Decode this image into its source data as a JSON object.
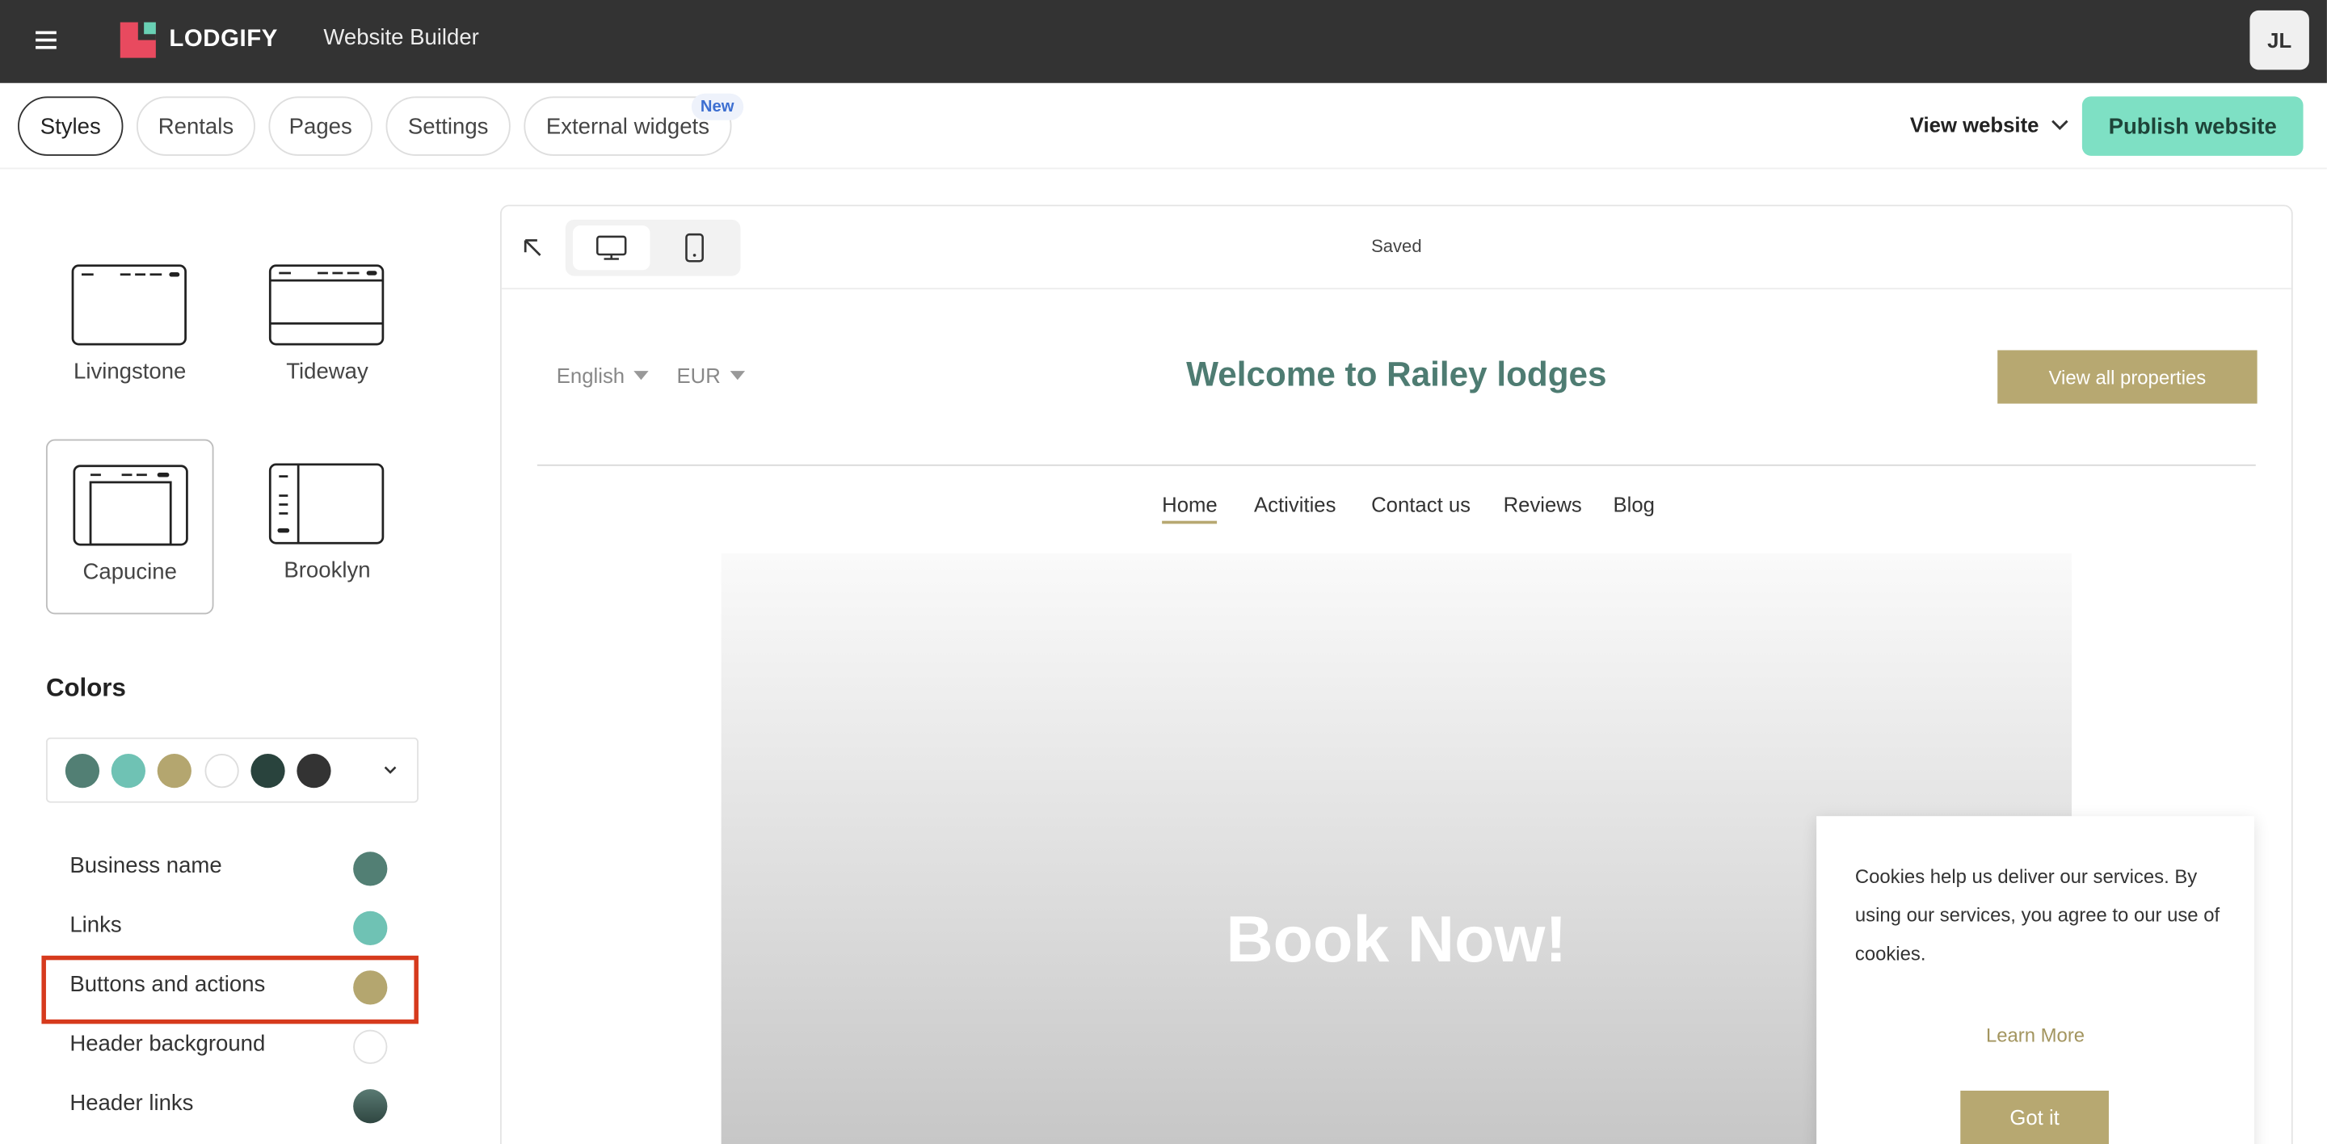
{
  "topbar": {
    "logo_text": "LODGIFY",
    "app_title": "Website Builder",
    "avatar_initials": "JL"
  },
  "tabs": {
    "items": [
      {
        "label": "Styles",
        "active": true
      },
      {
        "label": "Rentals",
        "active": false
      },
      {
        "label": "Pages",
        "active": false
      },
      {
        "label": "Settings",
        "active": false
      },
      {
        "label": "External widgets",
        "active": false
      }
    ],
    "new_badge": "New",
    "view_website": "View website",
    "publish": "Publish website"
  },
  "sidebar": {
    "layouts": [
      {
        "name": "Livingstone",
        "selected": false
      },
      {
        "name": "Tideway",
        "selected": false
      },
      {
        "name": "Capucine",
        "selected": true
      },
      {
        "name": "Brooklyn",
        "selected": false
      }
    ],
    "colors_title": "Colors",
    "palette": [
      "#527f74",
      "#6fc2b4",
      "#b4a66f",
      "#ffffff",
      "#29433d",
      "#333333"
    ],
    "color_rows": [
      {
        "label": "Business name",
        "color": "#527f74"
      },
      {
        "label": "Links",
        "color": "#6fc2b4"
      },
      {
        "label": "Buttons and actions",
        "color": "#b4a66f"
      },
      {
        "label": "Header background",
        "color": "#ffffff"
      },
      {
        "label": "Header links",
        "color": "#44605a"
      }
    ]
  },
  "preview": {
    "status": "Saved",
    "site": {
      "language": "English",
      "currency": "EUR",
      "title": "Welcome to Railey lodges",
      "cta": "View all properties",
      "nav": [
        "Home",
        "Activities",
        "Contact us",
        "Reviews",
        "Blog"
      ],
      "hero_text": "Book Now!"
    },
    "cookie": {
      "text": "Cookies help us deliver our services. By using our services, you agree to our use of cookies.",
      "learn_more": "Learn More",
      "accept": "Got it"
    }
  }
}
